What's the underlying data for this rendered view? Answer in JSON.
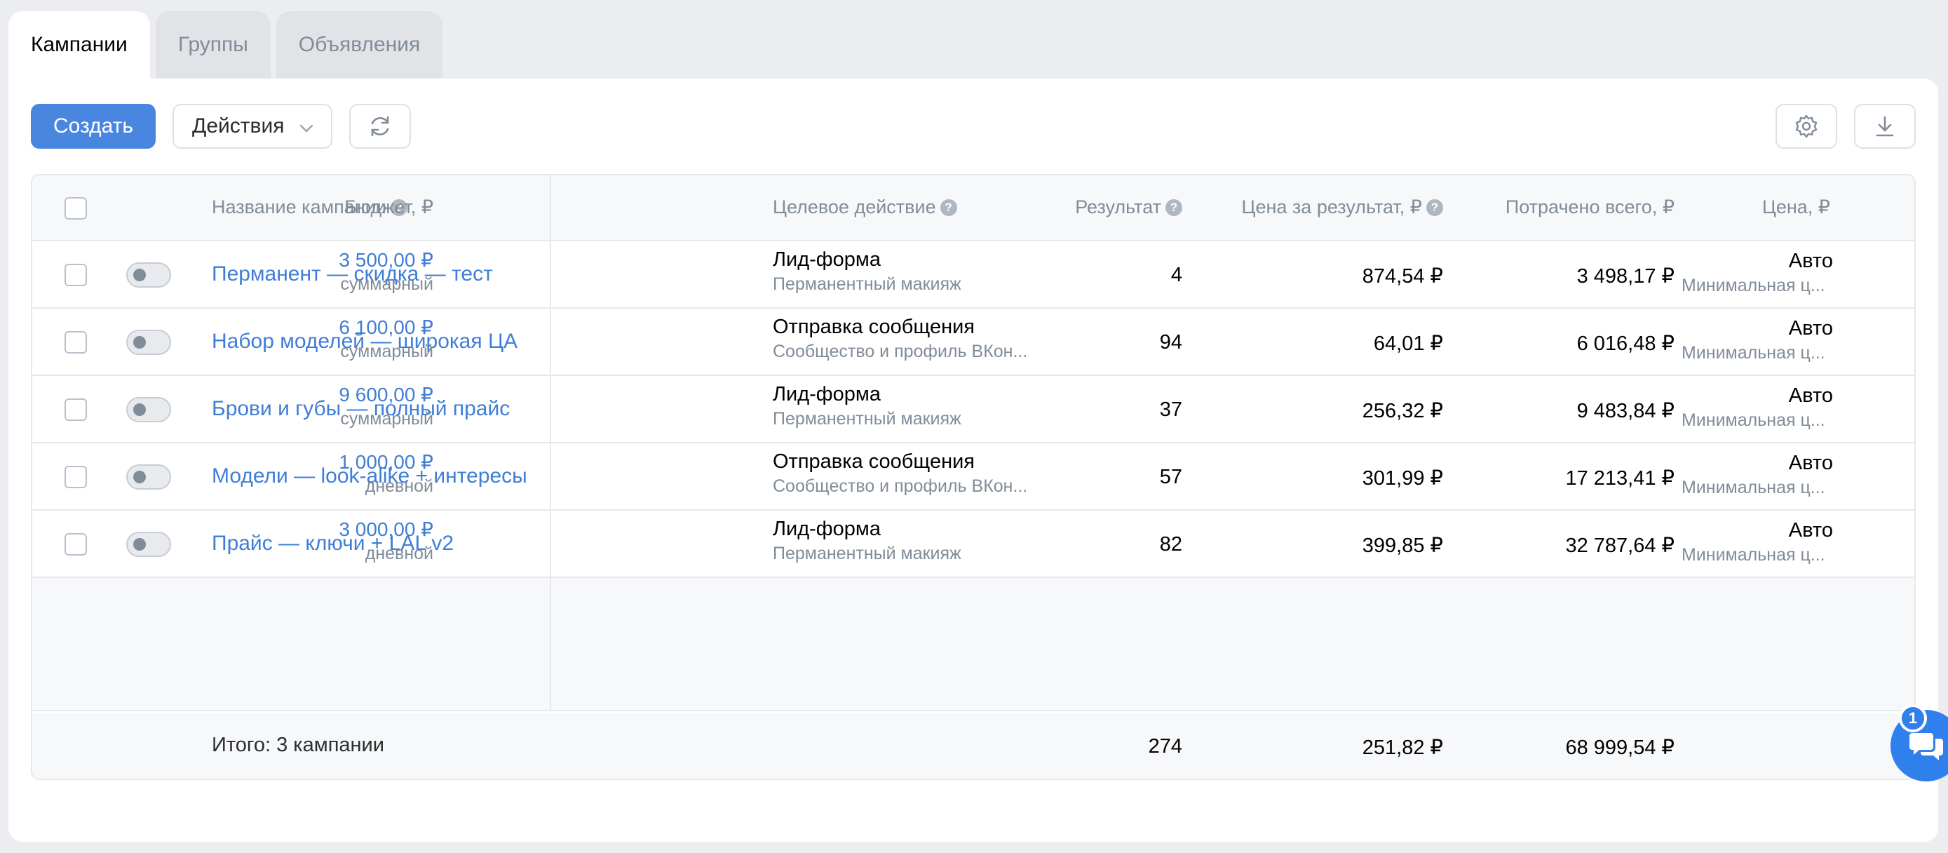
{
  "tabs": [
    {
      "label": "Кампании",
      "active": true
    },
    {
      "label": "Группы",
      "active": false
    },
    {
      "label": "Объявления",
      "active": false
    }
  ],
  "toolbar": {
    "create_label": "Создать",
    "actions_label": "Действия"
  },
  "icons": {
    "refresh": "refresh-icon",
    "settings": "gear-icon",
    "download": "download-icon",
    "chat": "chat-icon"
  },
  "table": {
    "headers": {
      "name": "Название кампании",
      "budget": "Бюджет, ₽",
      "target": "Целевое действие",
      "result": "Результат",
      "cost_per_result": "Цена за результат, ₽",
      "spent": "Потрачено всего, ₽",
      "price": "Цена, ₽"
    },
    "rows": [
      {
        "name": "Перманент — скидка — тест",
        "budget": "3 500,00 ₽",
        "budget_type": "суммарный",
        "target": "Лид-форма",
        "target_sub": "Перманентный макияж",
        "result": "4",
        "cost_per_result": "874,54 ₽",
        "spent": "3 498,17 ₽",
        "price": "Авто",
        "price_sub": "Минимальная ц..."
      },
      {
        "name": "Набор моделей — широкая ЦА",
        "budget": "6 100,00 ₽",
        "budget_type": "суммарный",
        "target": "Отправка сообщения",
        "target_sub": "Сообщество и профиль ВКон...",
        "result": "94",
        "cost_per_result": "64,01 ₽",
        "spent": "6 016,48 ₽",
        "price": "Авто",
        "price_sub": "Минимальная ц..."
      },
      {
        "name": "Брови и губы — полный прайс",
        "budget": "9 600,00 ₽",
        "budget_type": "суммарный",
        "target": "Лид-форма",
        "target_sub": "Перманентный макияж",
        "result": "37",
        "cost_per_result": "256,32 ₽",
        "spent": "9 483,84 ₽",
        "price": "Авто",
        "price_sub": "Минимальная ц..."
      },
      {
        "name": "Модели — look-alike + интересы",
        "budget": "1 000,00 ₽",
        "budget_type": "дневной",
        "target": "Отправка сообщения",
        "target_sub": "Сообщество и профиль ВКон...",
        "result": "57",
        "cost_per_result": "301,99 ₽",
        "spent": "17 213,41 ₽",
        "price": "Авто",
        "price_sub": "Минимальная ц..."
      },
      {
        "name": "Прайс — ключи + LAL v2",
        "budget": "3 000,00 ₽",
        "budget_type": "дневной",
        "target": "Лид-форма",
        "target_sub": "Перманентный макияж",
        "result": "82",
        "cost_per_result": "399,85 ₽",
        "spent": "32 787,64 ₽",
        "price": "Авто",
        "price_sub": "Минимальная ц..."
      }
    ],
    "footer": {
      "label": "Итого: 3 кампании",
      "result": "274",
      "cost_per_result": "251,82 ₽",
      "spent": "68 999,54 ₽"
    }
  },
  "chat": {
    "badge": "1"
  },
  "colors": {
    "accent": "#4986e0",
    "link": "#3f7ed6",
    "muted": "#818c99",
    "background": "#ebedf0"
  }
}
